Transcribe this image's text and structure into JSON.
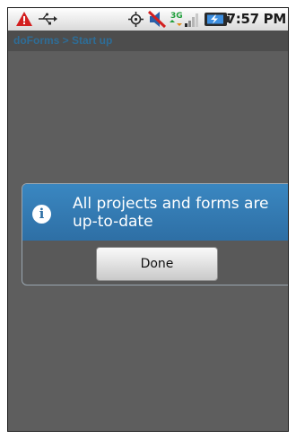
{
  "status_bar": {
    "time": "7:57 PM",
    "icons": [
      "warning-icon",
      "usb-icon",
      "gps-icon",
      "mute-icon",
      "network-3g-icon",
      "signal-icon",
      "battery-icon"
    ],
    "network_label": "3G"
  },
  "app_bar": {
    "title": "doForms > Start up"
  },
  "dialog": {
    "icon": "info-icon",
    "icon_glyph": "i",
    "message": "All projects and forms are up-to-date",
    "button_label": "Done"
  },
  "colors": {
    "dialog_header": "#2e6fa5",
    "title_text": "#2e6d97",
    "background": "#5e5e5e"
  }
}
